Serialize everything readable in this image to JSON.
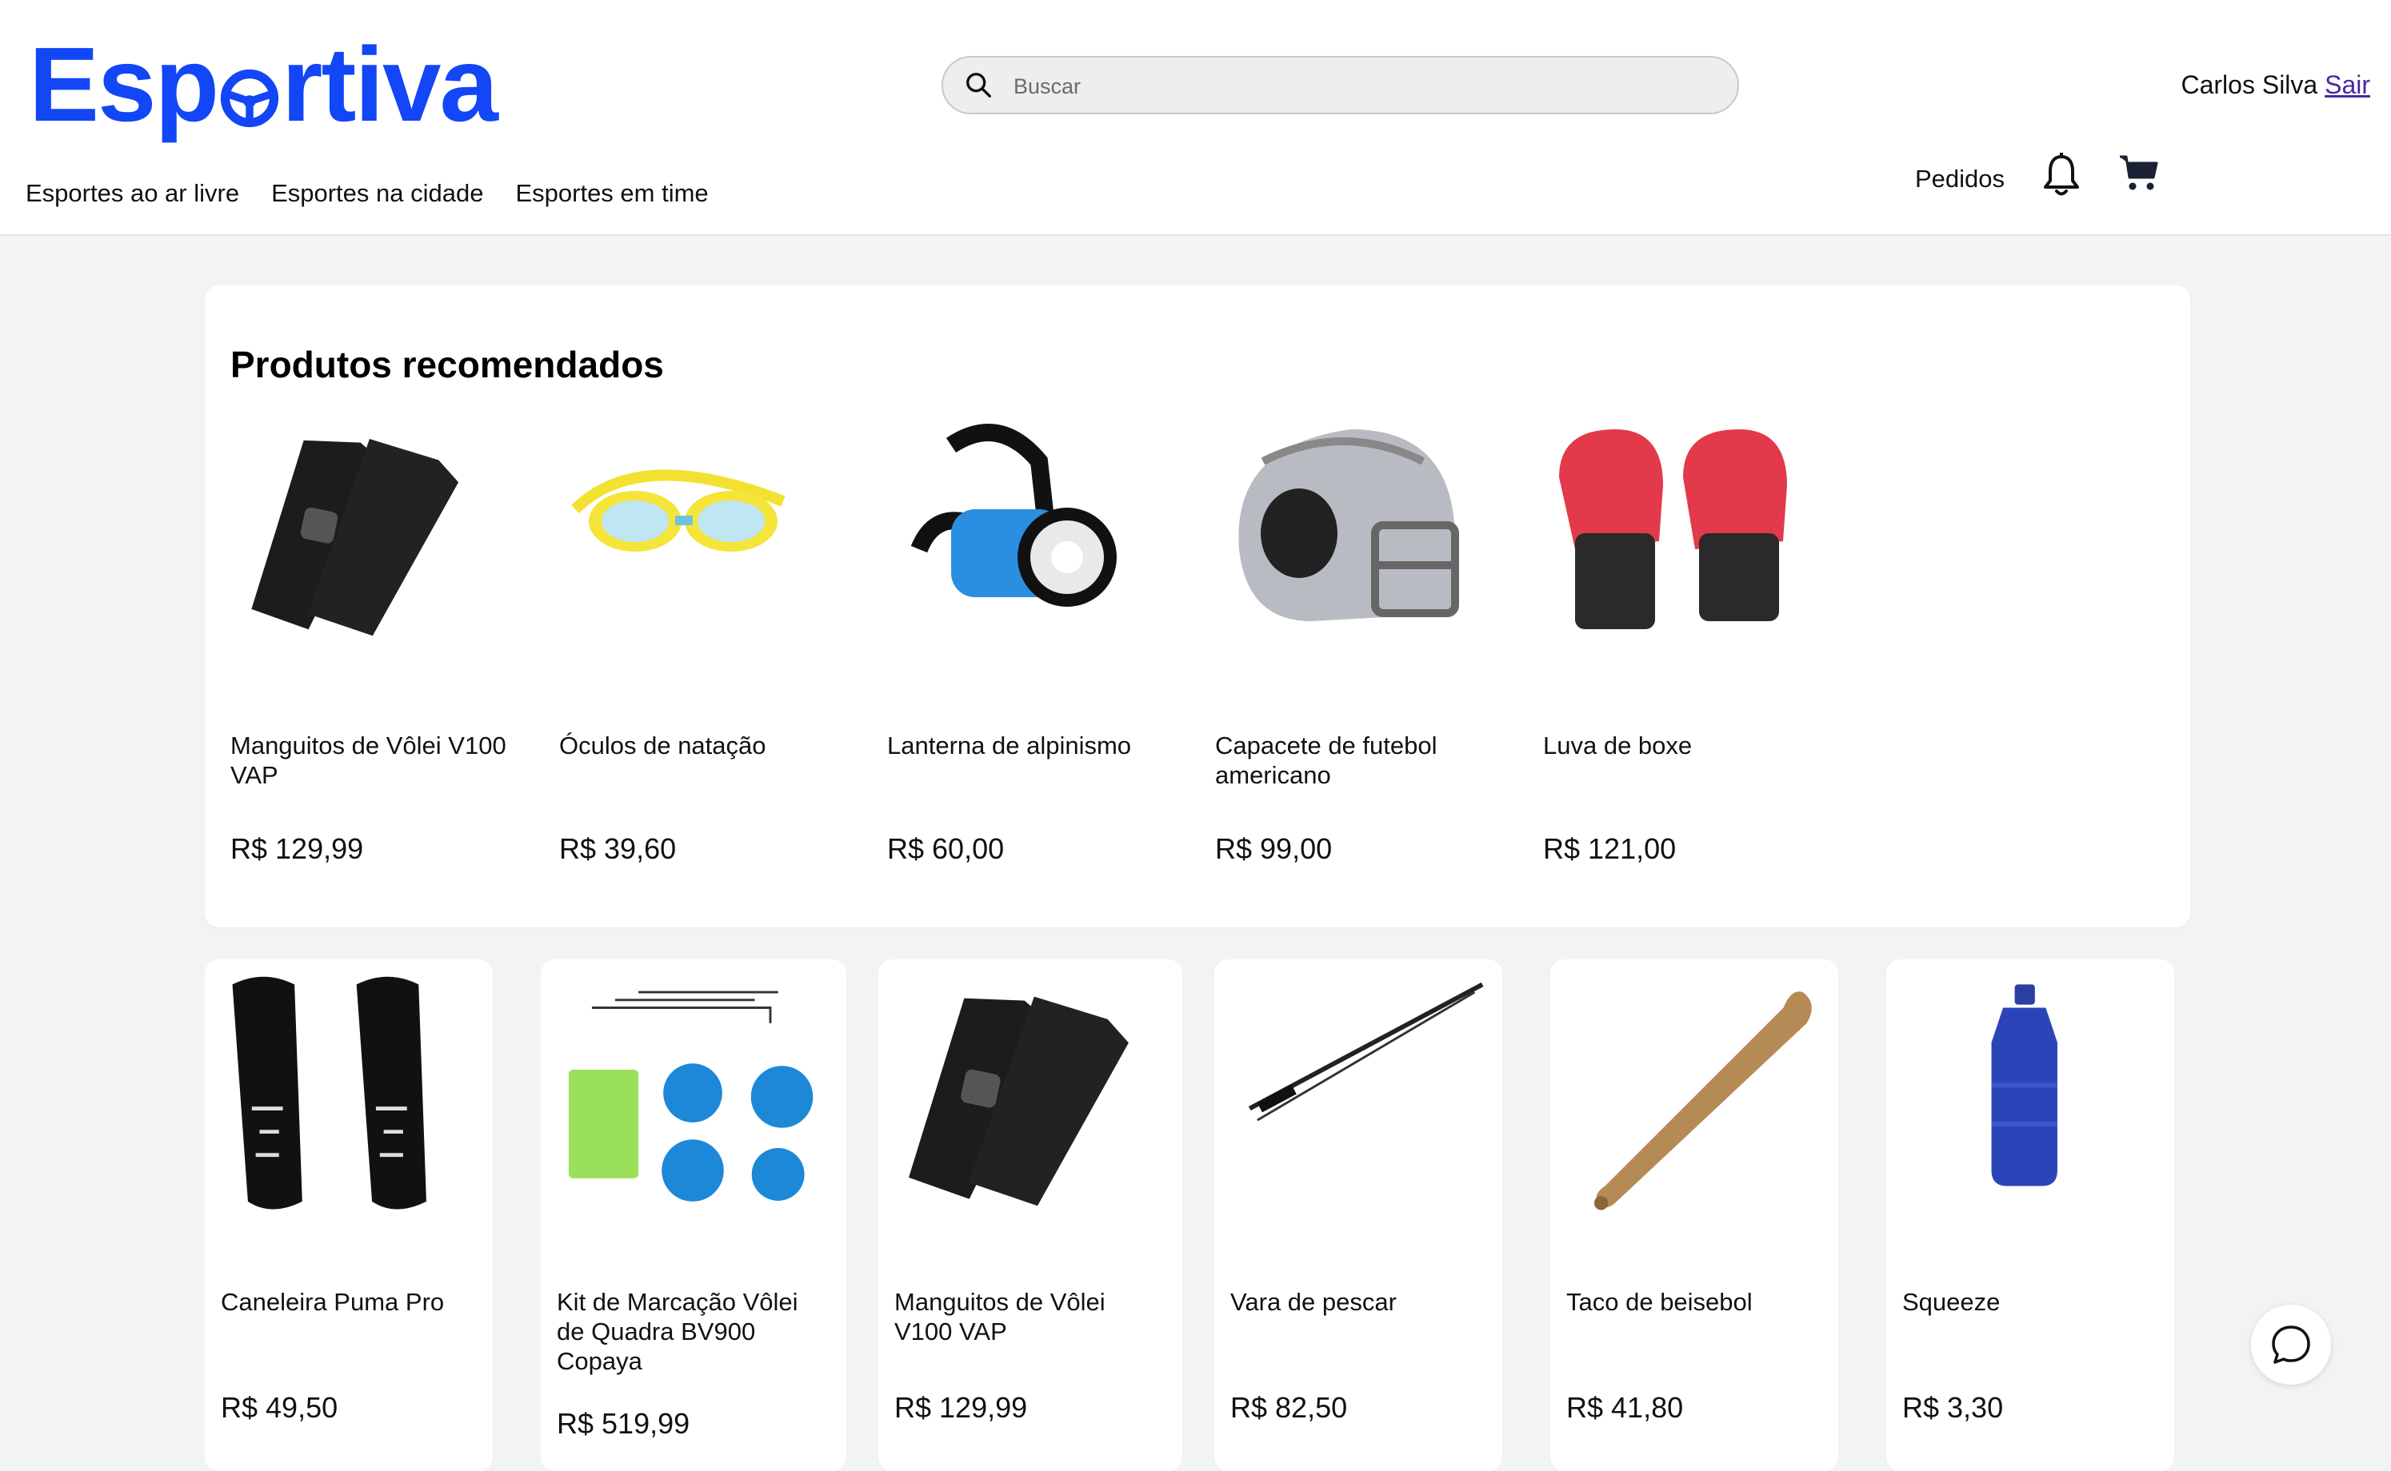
{
  "header": {
    "logo": "Esportiva",
    "search": {
      "placeholder": "Buscar",
      "value": ""
    },
    "user": {
      "name": "Carlos Silva",
      "logout": "Sair"
    },
    "nav": [
      "Esportes ao ar livre",
      "Esportes na cidade",
      "Esportes em time"
    ],
    "orders": "Pedidos",
    "icons": [
      "search-icon",
      "bell-icon",
      "cart-icon"
    ]
  },
  "recommended": {
    "title": "Produtos recomendados",
    "items": [
      {
        "name": "Manguitos de Vôlei V100 VAP",
        "price": "R$ 129,99"
      },
      {
        "name": "Óculos de natação",
        "price": "R$ 39,60"
      },
      {
        "name": "Lanterna de alpinismo",
        "price": "R$ 60,00"
      },
      {
        "name": "Capacete de futebol americano",
        "price": "R$ 99,00"
      },
      {
        "name": "Luva de boxe",
        "price": "R$ 121,00"
      }
    ]
  },
  "products": [
    {
      "name": "Caneleira Puma Pro",
      "price": "R$ 49,50"
    },
    {
      "name": "Kit de Marcação Vôlei de Quadra BV900 Copaya",
      "price": "R$ 519,99"
    },
    {
      "name": "Manguitos de Vôlei V100 VAP",
      "price": "R$ 129,99"
    },
    {
      "name": "Vara de pescar",
      "price": "R$ 82,50"
    },
    {
      "name": "Taco de beisebol",
      "price": "R$ 41,80"
    },
    {
      "name": "Squeeze",
      "price": "R$ 3,30"
    }
  ],
  "colors": {
    "brand": "#1246f6",
    "background": "#f2f3f5",
    "card": "#ffffff"
  }
}
